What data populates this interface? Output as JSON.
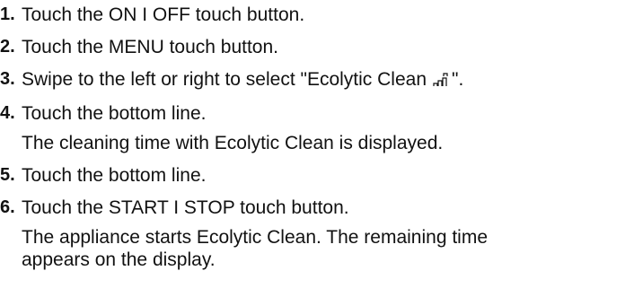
{
  "steps": [
    {
      "number": "1.",
      "lines": [
        "Touch the ON I OFF touch button."
      ]
    },
    {
      "number": "2.",
      "lines": [
        "Touch the MENU touch button."
      ]
    },
    {
      "number": "3.",
      "text_before_icon": "Swipe to the left or right to select \"Ecolytic Clean",
      "icon": "ecolytic-clean-icon",
      "text_after_icon": "\"."
    },
    {
      "number": "4.",
      "lines": [
        "Touch the bottom line.",
        "The cleaning time with Ecolytic Clean is displayed."
      ]
    },
    {
      "number": "5.",
      "lines": [
        "Touch the bottom line."
      ]
    },
    {
      "number": "6.",
      "lines": [
        "Touch the START I STOP touch button.",
        "The appliance starts Ecolytic Clean. The remaining time appears on the display."
      ]
    }
  ]
}
